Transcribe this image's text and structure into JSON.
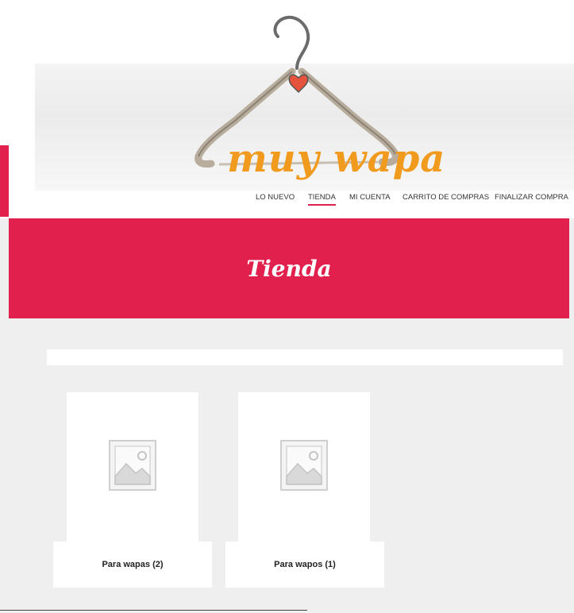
{
  "header": {
    "logo_text": "muy wapa",
    "nav": [
      {
        "label": "LO NUEVO",
        "active": false
      },
      {
        "label": "TIENDA",
        "active": true
      },
      {
        "label": "MI CUENTA",
        "active": false
      },
      {
        "label": "CARRITO DE COMPRAS",
        "active": false
      },
      {
        "label": "FINALIZAR COMPRA",
        "active": false
      }
    ]
  },
  "hero": {
    "title": "Tienda"
  },
  "categories": [
    {
      "label": "Para wapas (2)",
      "icon": "image-placeholder-icon"
    },
    {
      "label": "Para wapos (1)",
      "icon": "image-placeholder-icon"
    }
  ],
  "colors": {
    "accent": "#e1204d",
    "logo": "#f09a1e",
    "background": "#efefef"
  }
}
